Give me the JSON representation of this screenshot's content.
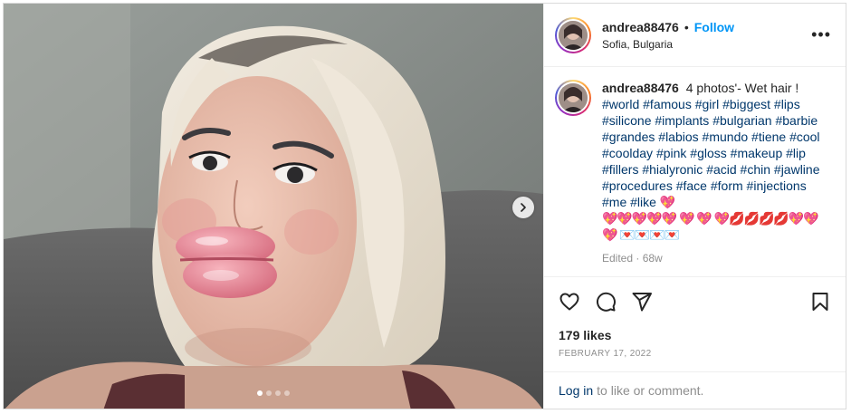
{
  "post": {
    "username": "andrea88476",
    "separator": "•",
    "follow_label": "Follow",
    "location": "Sofia, Bulgaria",
    "more_label": "•••"
  },
  "caption": {
    "username": "andrea88476",
    "text_intro": "4 photos'- Wet hair !",
    "hashtags": [
      "#world",
      "#famous",
      "#girl",
      "#biggest",
      "#lips",
      "#silicone",
      "#implants",
      "#bulgarian",
      "#barbie",
      "#grandes",
      "#labios",
      "#mundo",
      "#tiene",
      "#cool",
      "#coolday",
      "#pink",
      "#gloss",
      "#makeup",
      "#lip",
      "#fillers",
      "#hialyronic",
      "#acid",
      "#chin",
      "#jawline",
      "#procedures",
      "#face",
      "#form",
      "#injections",
      "#me",
      "#like"
    ],
    "emoji_line_1": "💖",
    "emoji_line_2": "💖💖💖💖💖 💖 💖 💖💋💋💋💋💖💖",
    "emoji_line_3": "💖 💌💌💌💌",
    "edited": "Edited · 68w"
  },
  "actions": {
    "like": "heart-outline",
    "comment": "comment-bubble",
    "share": "paper-plane",
    "save": "bookmark"
  },
  "likes": "179 likes",
  "date": "FEBRUARY 17, 2022",
  "login": {
    "link": "Log in",
    "rest": "to like or comment."
  },
  "carousel": {
    "count": 4,
    "active": 0
  }
}
